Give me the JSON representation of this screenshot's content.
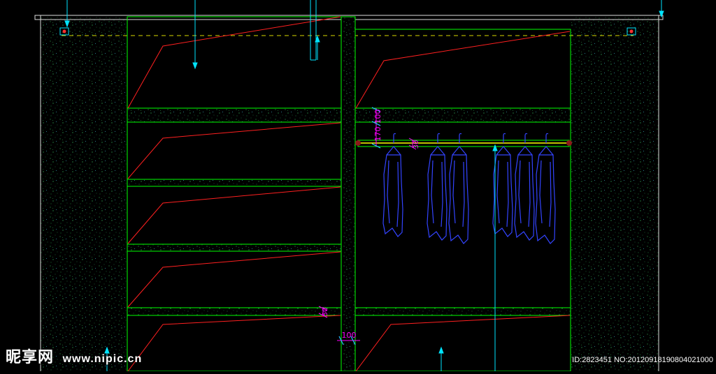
{
  "dimensions": {
    "d100_top": "100",
    "d170": "170",
    "d30": "30",
    "d50": "50",
    "d100_bottom": "100"
  },
  "watermark": {
    "brand": "昵享网",
    "url": "www.nipic.cn",
    "id_text": "ID:2823451 NO:20120918190804021000"
  },
  "colors": {
    "background": "#000000",
    "panel": "#00ff00",
    "shelf_slope": "#ff2020",
    "dimension": "#ff00ff",
    "leader": "#00e5ff",
    "clothes": "#3344ff",
    "rail": "#ffff00",
    "wall_hatch": "#22aa44"
  }
}
